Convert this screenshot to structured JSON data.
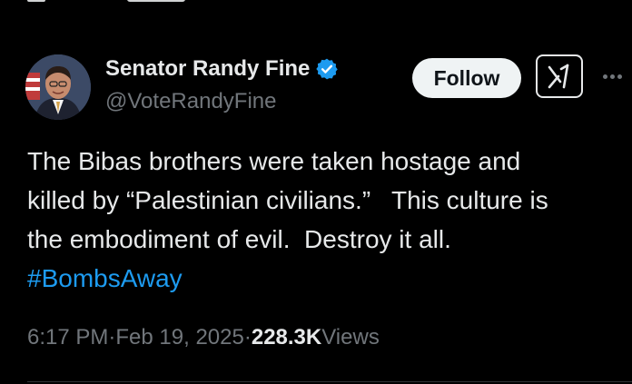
{
  "author": {
    "display_name": "Senator Randy Fine",
    "handle": "@VoteRandyFine",
    "verified": true,
    "verified_color": "#1d9bf0"
  },
  "actions": {
    "follow_label": "Follow",
    "grok_icon": "grok-icon",
    "more_icon": "more-icon"
  },
  "tweet": {
    "text": "The Bibas brothers were taken hostage and\nkilled by “Palestinian civilians.”   This culture is\nthe embodiment of evil.  Destroy it all.\n",
    "hashtag": "#BombsAway",
    "hashtag_color": "#1d9bf0"
  },
  "meta": {
    "time": "6:17 PM",
    "sep1": " · ",
    "date": "Feb 19, 2025",
    "sep2": " · ",
    "views_count": "228.3K",
    "views_label": " Views"
  },
  "colors": {
    "background": "#000000",
    "text": "#e7e9ea",
    "muted": "#71767b",
    "follow_bg": "#eff3f4"
  }
}
